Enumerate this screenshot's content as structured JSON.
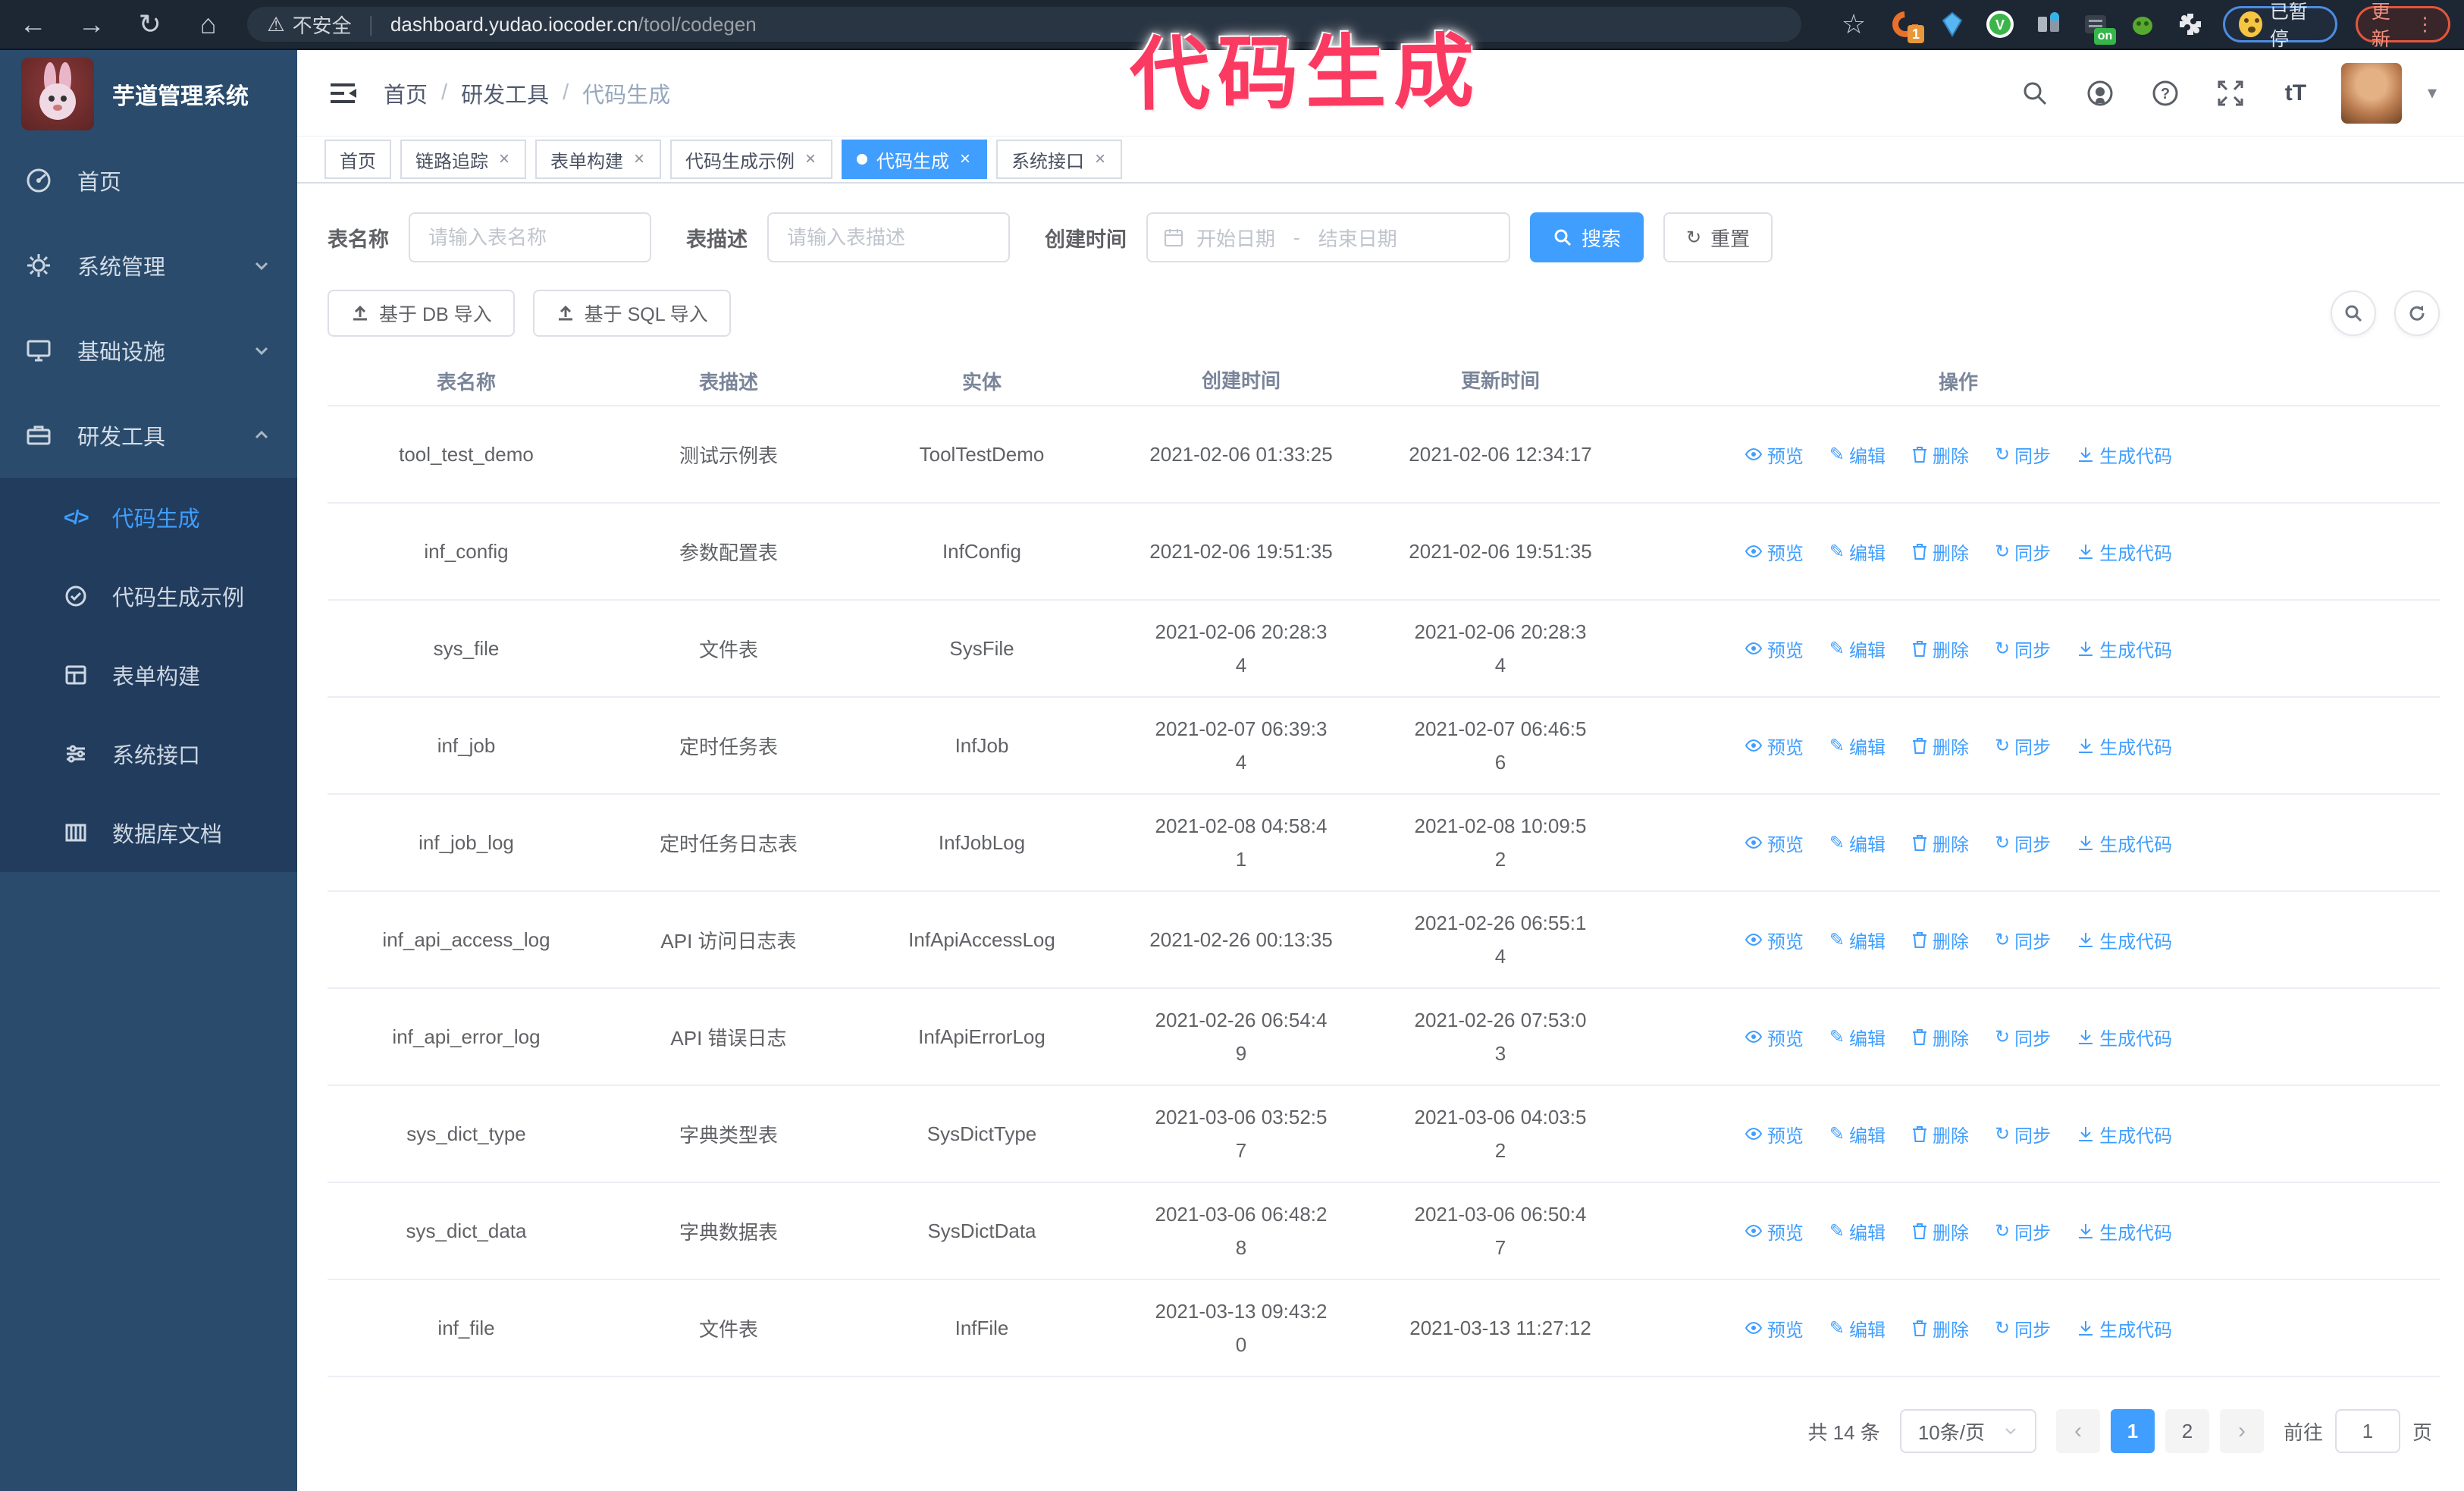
{
  "browser": {
    "back": "←",
    "forward": "→",
    "reload": "↻",
    "home": "⌂",
    "warning_glyph": "⚠",
    "security_warning": "不安全",
    "divider": "|",
    "url_domain": "dashboard.yudao.iocoder.cn",
    "url_path": "/tool/codegen",
    "star": "☆",
    "ext_badge": "1",
    "ext_on_badge": "on",
    "ext_check_glyph": "V",
    "paused_badge": "已暂停",
    "update_button": "更新",
    "dots": "⋮"
  },
  "annotation": {
    "text": "代码生成",
    "color": "#fb3a62"
  },
  "sidebar": {
    "logo_title": "芋道管理系统",
    "items": [
      {
        "label": "首页"
      },
      {
        "label": "系统管理"
      },
      {
        "label": "基础设施"
      },
      {
        "label": "研发工具"
      }
    ],
    "submenu": [
      {
        "label": "代码生成"
      },
      {
        "label": "代码生成示例"
      },
      {
        "label": "表单构建"
      },
      {
        "label": "系统接口"
      },
      {
        "label": "数据库文档"
      }
    ],
    "code_icon_glyph": "</>"
  },
  "header": {
    "breadcrumb": [
      "首页",
      "研发工具",
      "代码生成"
    ],
    "breadcrumb_separator": "/",
    "font_size_glyph": "tT",
    "help_glyph": "?",
    "caret_glyph": "▾"
  },
  "tabs": [
    {
      "label": "首页"
    },
    {
      "label": "链路追踪"
    },
    {
      "label": "表单构建"
    },
    {
      "label": "代码生成示例"
    },
    {
      "label": "代码生成"
    },
    {
      "label": "系统接口"
    }
  ],
  "tab_close_glyph": "×",
  "filters": {
    "table_name_label": "表名称",
    "table_name_placeholder": "请输入表名称",
    "table_desc_label": "表描述",
    "table_desc_placeholder": "请输入表描述",
    "create_time_label": "创建时间",
    "date_start_placeholder": "开始日期",
    "date_separator": "-",
    "date_end_placeholder": "结束日期",
    "search_label": "搜索",
    "reset_label": "重置",
    "reset_glyph": "↻"
  },
  "toolbar": {
    "import_db_label": "基于 DB 导入",
    "import_sql_label": "基于 SQL 导入"
  },
  "table": {
    "columns": [
      "表名称",
      "表描述",
      "实体",
      "创建时间",
      "更新时间",
      "操作"
    ],
    "actions": [
      "预览",
      "编辑",
      "删除",
      "同步",
      "生成代码"
    ],
    "edit_glyph": "✎",
    "sync_glyph": "↻",
    "rows": [
      {
        "name": "tool_test_demo",
        "desc": "测试示例表",
        "entity": "ToolTestDemo",
        "created": "2021-02-06 01:33:25",
        "updated": "2021-02-06 12:34:17"
      },
      {
        "name": "inf_config",
        "desc": "参数配置表",
        "entity": "InfConfig",
        "created": "2021-02-06 19:51:35",
        "updated": "2021-02-06 19:51:35"
      },
      {
        "name": "sys_file",
        "desc": "文件表",
        "entity": "SysFile",
        "created": "2021-02-06 20:28:3\n4",
        "updated": "2021-02-06 20:28:3\n4"
      },
      {
        "name": "inf_job",
        "desc": "定时任务表",
        "entity": "InfJob",
        "created": "2021-02-07 06:39:3\n4",
        "updated": "2021-02-07 06:46:5\n6"
      },
      {
        "name": "inf_job_log",
        "desc": "定时任务日志表",
        "entity": "InfJobLog",
        "created": "2021-02-08 04:58:4\n1",
        "updated": "2021-02-08 10:09:5\n2"
      },
      {
        "name": "inf_api_access_log",
        "desc": "API 访问日志表",
        "entity": "InfApiAccessLog",
        "created": "2021-02-26 00:13:35",
        "updated": "2021-02-26 06:55:1\n4"
      },
      {
        "name": "inf_api_error_log",
        "desc": "API 错误日志",
        "entity": "InfApiErrorLog",
        "created": "2021-02-26 06:54:4\n9",
        "updated": "2021-02-26 07:53:0\n3"
      },
      {
        "name": "sys_dict_type",
        "desc": "字典类型表",
        "entity": "SysDictType",
        "created": "2021-03-06 03:52:5\n7",
        "updated": "2021-03-06 04:03:5\n2"
      },
      {
        "name": "sys_dict_data",
        "desc": "字典数据表",
        "entity": "SysDictData",
        "created": "2021-03-06 06:48:2\n8",
        "updated": "2021-03-06 06:50:4\n7"
      },
      {
        "name": "inf_file",
        "desc": "文件表",
        "entity": "InfFile",
        "created": "2021-03-13 09:43:2\n0",
        "updated": "2021-03-13 11:27:12"
      }
    ]
  },
  "pagination": {
    "total": "共 14 条",
    "page_size": "10条/页",
    "prev_glyph": "‹",
    "next_glyph": "›",
    "pages": [
      "1",
      "2"
    ],
    "goto_label": "前往",
    "goto_value": "1",
    "goto_suffix": "页"
  },
  "colors": {
    "primary": "#409eff",
    "sidebar_bg": "#2a4b6c",
    "submenu_bg": "#223c5d",
    "annotation": "#fb3a62"
  }
}
